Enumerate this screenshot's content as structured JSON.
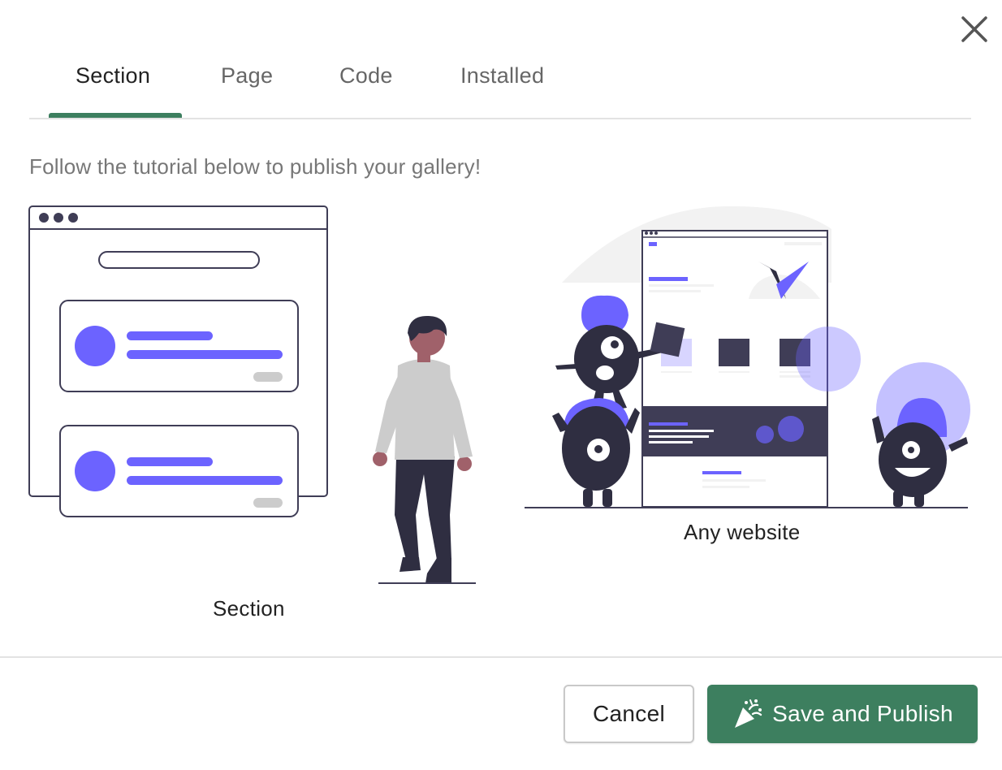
{
  "tabs": [
    {
      "label": "Section",
      "active": true
    },
    {
      "label": "Page",
      "active": false
    },
    {
      "label": "Code",
      "active": false
    },
    {
      "label": "Installed",
      "active": false
    }
  ],
  "instructions": "Follow the tutorial below to publish your gallery!",
  "illustrations": {
    "section_caption": "Section",
    "website_caption": "Any website"
  },
  "footer": {
    "cancel_label": "Cancel",
    "publish_label": "Save and Publish"
  },
  "icons": {
    "close": "close-icon",
    "publish": "party-popper-icon"
  },
  "colors": {
    "accent": "#3d7f5f",
    "illustration_primary": "#6c63ff",
    "illustration_dark": "#2f2e41"
  }
}
